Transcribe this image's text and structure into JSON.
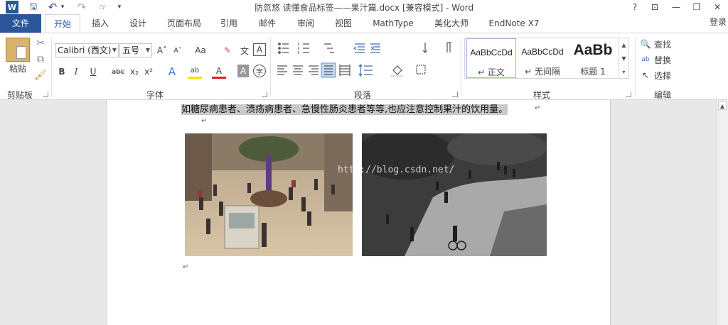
{
  "window": {
    "title": "防忽悠  读懂食品标签——果汁篇.docx [兼容模式] - Word",
    "help": "?",
    "controls": {
      "ribbon_options": "⊡",
      "minimize": "—",
      "restore": "❐",
      "close": "✕"
    }
  },
  "quick_access": {
    "app_icon": "W",
    "save": "🖫",
    "undo": "↶",
    "undo_dd": "▾",
    "redo": "↷",
    "touch": "☞",
    "customize": "▾"
  },
  "tabs": [
    "文件",
    "开始",
    "插入",
    "设计",
    "页面布局",
    "引用",
    "邮件",
    "审阅",
    "视图",
    "MathType",
    "美化大师",
    "EndNote X7"
  ],
  "login": "登录",
  "ribbon": {
    "clipboard": {
      "paste_label": "粘贴",
      "group_label": "剪贴板"
    },
    "font": {
      "font_name": "Calibri (西文)",
      "font_size": "五号",
      "grow": "A˄",
      "shrink": "A˅",
      "case": "Aa",
      "clear": "✎",
      "phonetic": "文",
      "border_char": "A",
      "bold": "B",
      "italic": "I",
      "underline": "U",
      "strike": "abc",
      "subscript": "x₂",
      "superscript": "x²",
      "effects": "A",
      "highlight": "ab",
      "font_color": "A",
      "shading": "A",
      "enclose": "字",
      "group_label": "字体"
    },
    "paragraph": {
      "group_label": "段落"
    },
    "styles": {
      "items": [
        {
          "sample": "AaBbCcDd",
          "name": "↵ 正文"
        },
        {
          "sample": "AaBbCcDd",
          "name": "↵ 无间隔"
        },
        {
          "sample": "AaBb",
          "name": "标题 1"
        }
      ],
      "group_label": "样式"
    },
    "editing": {
      "find": "查找",
      "replace": "替换",
      "select": "选择",
      "group_label": "编辑"
    }
  },
  "document": {
    "paragraph1": "如糖尿病患者、溃疡病患者、急慢性肠炎患者等等,也应注意控制果汁的饮用量。",
    "return_mark": "↵",
    "watermark": "http://blog.csdn.net/"
  }
}
